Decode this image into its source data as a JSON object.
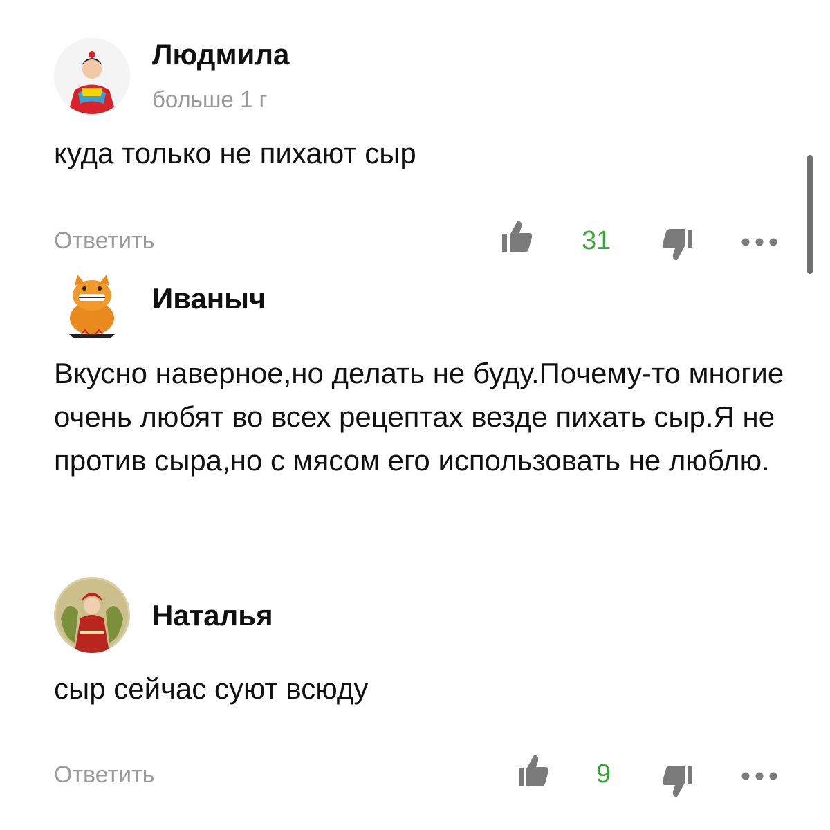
{
  "comments": [
    {
      "author": "Людмила",
      "time": "больше 1 г",
      "text": "куда только не пихают сыр",
      "reply_label": "Ответить",
      "likes": "31",
      "avatar_icon": "girl-in-hanbok-avatar"
    },
    {
      "author": "Иваныч",
      "text": "Вкусно наверное,но делать не буду.Почему-то многие очень любят во всех рецептах везде пихать сыр.Я не против сыра,но с мясом его использовать не люблю.",
      "avatar_icon": "orange-cat-avatar"
    },
    {
      "author": "Наталья",
      "text": "сыр сейчас суют всюду",
      "reply_label": "Ответить",
      "likes": "9",
      "avatar_icon": "painted-woman-avatar"
    }
  ],
  "icons": {
    "like": "thumbs-up-icon",
    "dislike": "thumbs-down-icon",
    "more": "more-dots-icon"
  },
  "colors": {
    "likes_count": "#3aa53a",
    "muted_text": "#9a9a9a",
    "text": "#111111"
  }
}
